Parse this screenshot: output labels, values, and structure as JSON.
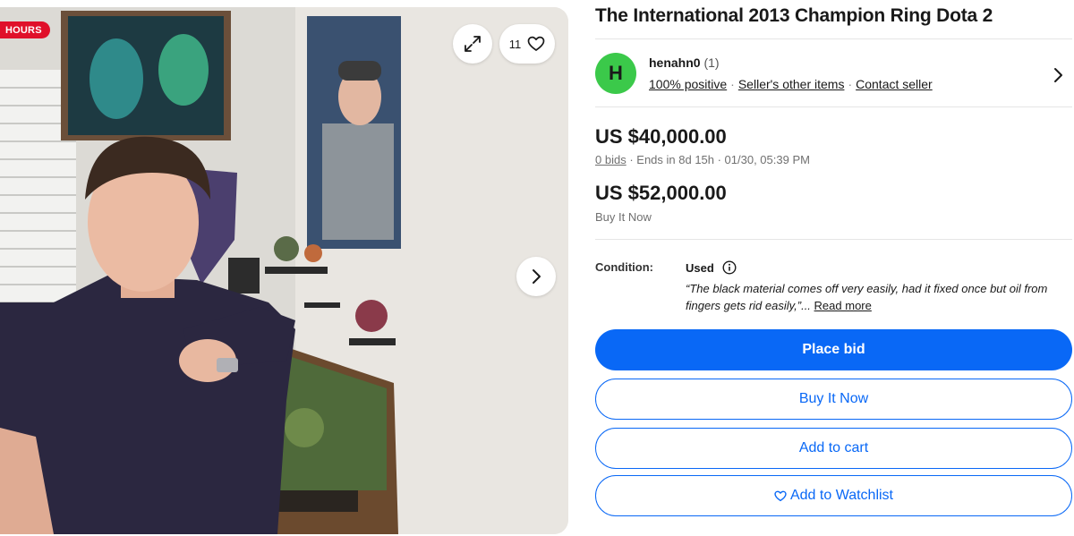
{
  "gallery": {
    "badge": "HOURS",
    "watchers_count": "11",
    "icons": {
      "expand": "expand-icon",
      "heart": "heart-icon",
      "next": "chevron-right-icon"
    }
  },
  "listing": {
    "title": "The International 2013 Champion Ring Dota 2"
  },
  "seller": {
    "avatar_letter": "H",
    "avatar_color": "#3bc94a",
    "name": "henahn0",
    "feedback_count": "(1)",
    "positive": "100% positive",
    "other_items": "Seller's other items",
    "contact": "Contact seller"
  },
  "pricing": {
    "bid_price": "US $40,000.00",
    "bids": "0 bids",
    "ends": "· Ends in 8d 15h · 01/30, 05:39 PM",
    "bin_price": "US $52,000.00",
    "bin_label": "Buy It Now"
  },
  "condition": {
    "label": "Condition:",
    "value": "Used",
    "quote": "“The black material comes off very easily, had it fixed once but oil from fingers gets rid easily,”...",
    "read_more": "Read more"
  },
  "actions": {
    "place_bid": "Place bid",
    "buy_it_now": "Buy It Now",
    "add_to_cart": "Add to cart",
    "add_to_watchlist": "Add to Watchlist"
  },
  "colors": {
    "primary": "#0968f6",
    "badge": "#e0102a"
  }
}
